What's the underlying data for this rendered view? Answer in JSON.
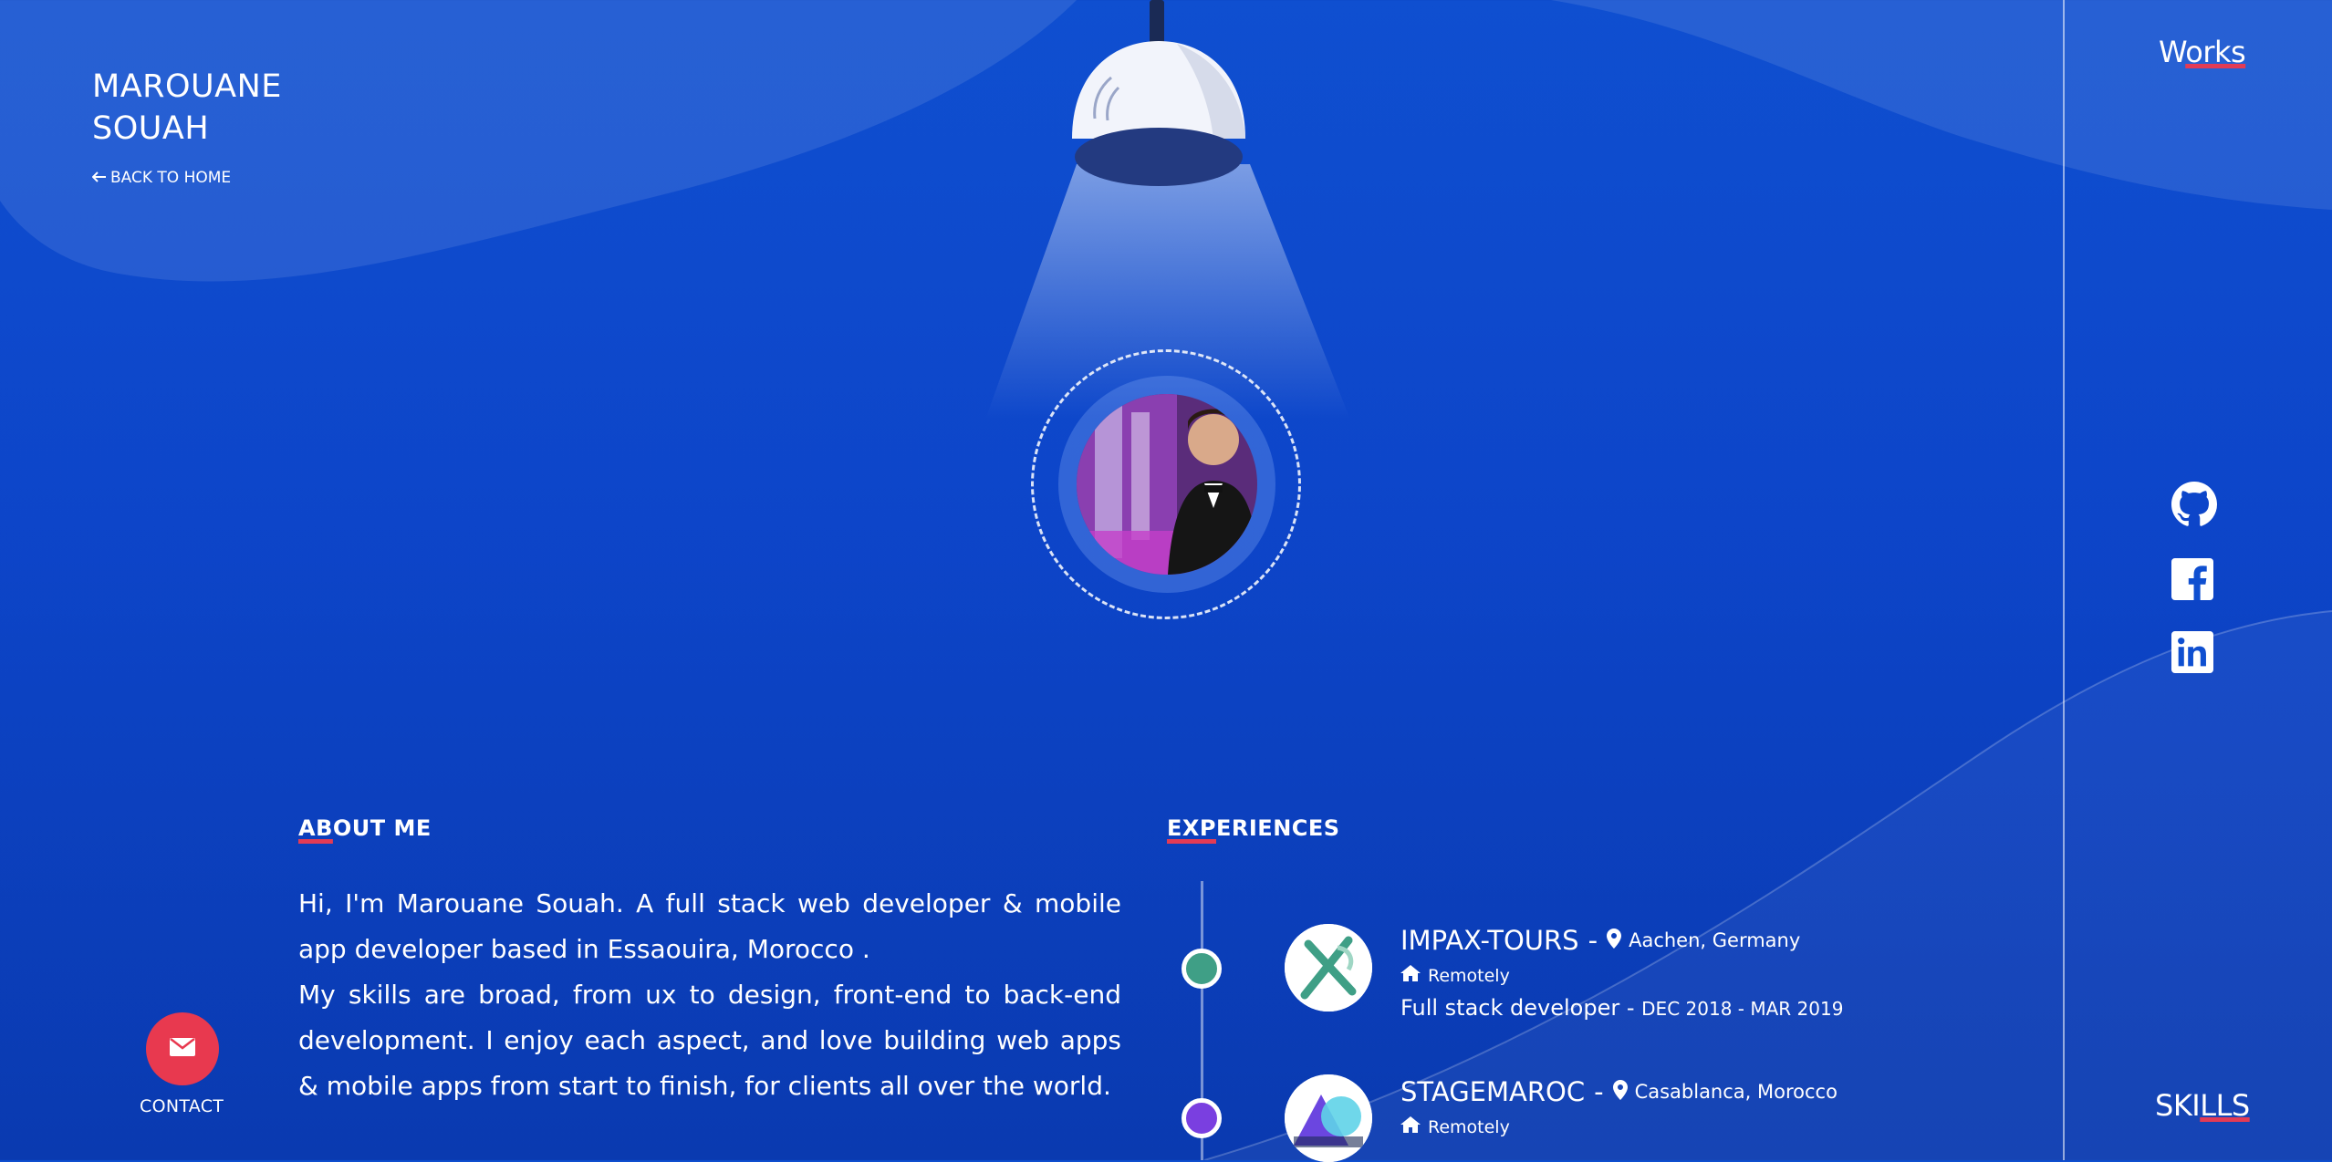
{
  "header": {
    "name_line1": "MAROUANE",
    "name_line2": "SOUAH",
    "back_label": "BACK TO HOME",
    "back_icon": "arrow-left-icon"
  },
  "nav": {
    "works": {
      "pre": "W",
      "underlined": "orks"
    },
    "skills": {
      "pre": "SKI",
      "underlined": "LLS"
    }
  },
  "social": [
    {
      "name": "github",
      "icon": "github-icon"
    },
    {
      "name": "facebook",
      "icon": "facebook-icon"
    },
    {
      "name": "linkedin",
      "icon": "linkedin-icon"
    }
  ],
  "about": {
    "heading_under": "AB",
    "heading_rest": "OUT ME",
    "para1": "Hi, I'm Marouane Souah. A full stack web developer & mobile app developer based in Essaouira, Morocco .",
    "para2": "My skills are broad, from ux to design, front-end to back-end development. I enjoy each aspect, and love building web apps & mobile apps from start to finish, for clients all over the world."
  },
  "experiences": {
    "heading_under": "EXP",
    "heading_rest": "ERIENCES",
    "items": [
      {
        "company": "IMPAX-TOURS",
        "sep": "-",
        "location": "Aachen, Germany",
        "remote": "Remotely",
        "role": "Full stack developer",
        "role_sep": "-",
        "dates": "DEC 2018 - MAR 2019",
        "dot_color": "#3f9f86"
      },
      {
        "company": "STAGEMAROC",
        "sep": "-",
        "location": "Casablanca, Morocco",
        "remote": "Remotely",
        "dot_color": "#7a3fe0"
      }
    ]
  },
  "contact": {
    "label": "CONTACT",
    "icon": "envelope-icon"
  },
  "colors": {
    "background": "#0d45c9",
    "accent": "#e33b55",
    "contact_button": "#e8394f"
  }
}
